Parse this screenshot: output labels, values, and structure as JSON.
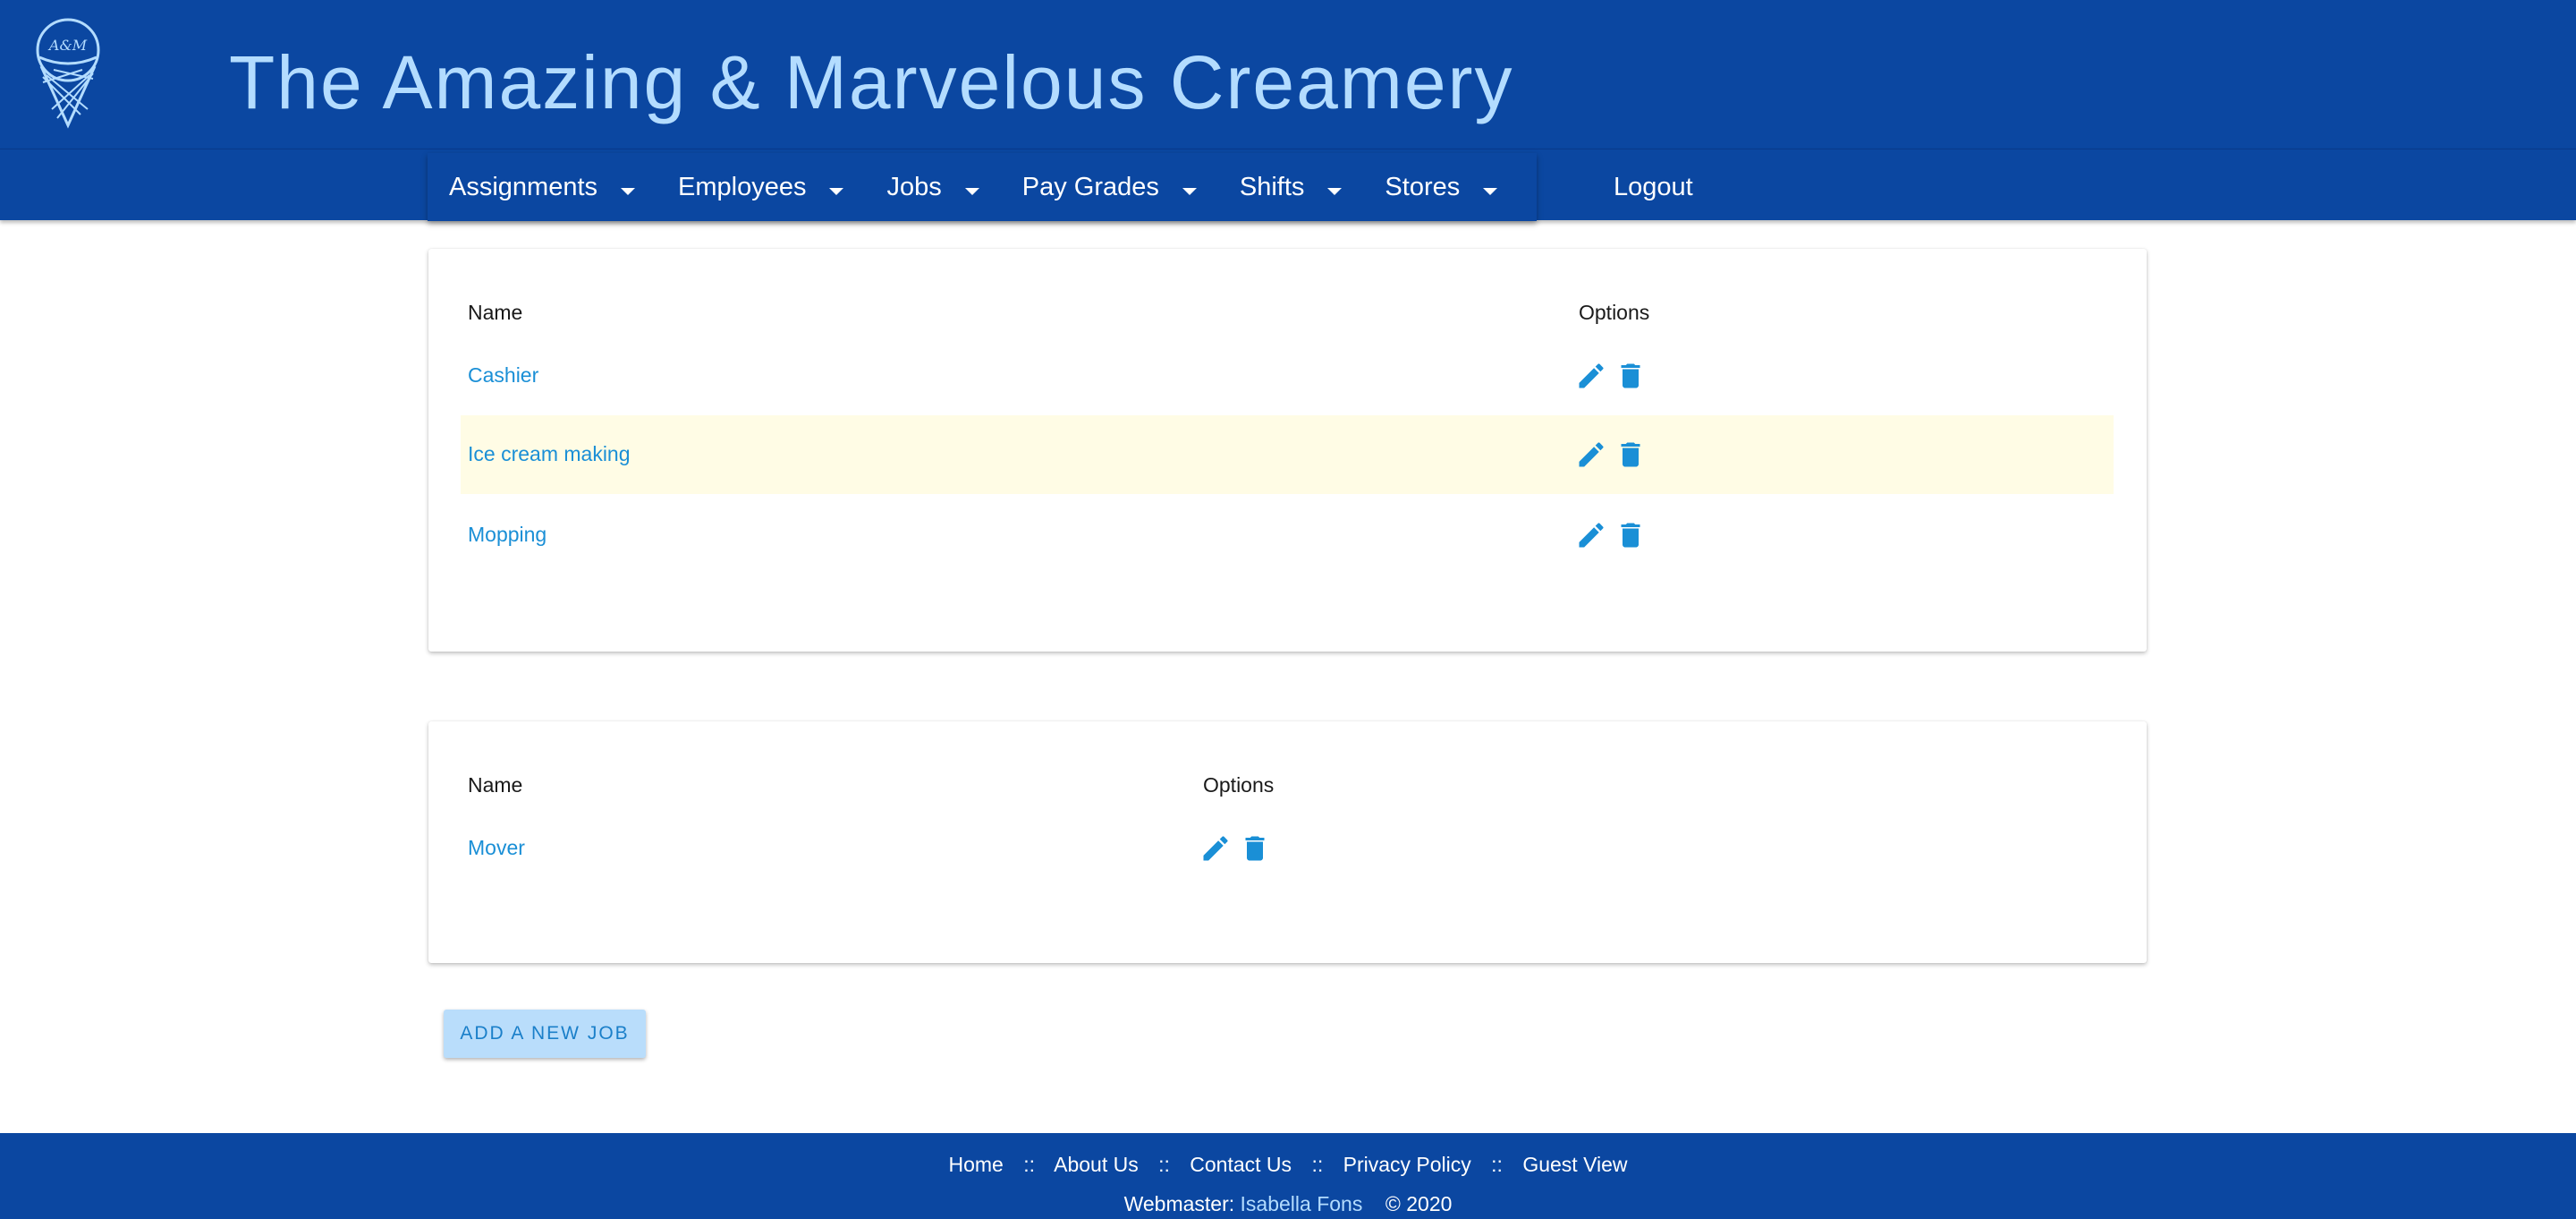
{
  "header": {
    "title": "The Amazing & Marvelous Creamery",
    "logo_icon": "ice-cream-cone-icon",
    "logo_text": "A&M"
  },
  "nav": {
    "items": [
      {
        "label": "Assignments",
        "icon": "caret-down-icon"
      },
      {
        "label": "Employees",
        "icon": "caret-down-icon"
      },
      {
        "label": "Jobs",
        "icon": "caret-down-icon"
      },
      {
        "label": "Pay Grades",
        "icon": "caret-down-icon"
      },
      {
        "label": "Shifts",
        "icon": "caret-down-icon"
      },
      {
        "label": "Stores",
        "icon": "caret-down-icon"
      }
    ],
    "logout_label": "Logout"
  },
  "active_jobs": {
    "headers": {
      "name": "Name",
      "options": "Options"
    },
    "rows": [
      {
        "name": "Cashier",
        "highlighted": false
      },
      {
        "name": "Ice cream making",
        "highlighted": true
      },
      {
        "name": "Mopping",
        "highlighted": false
      }
    ]
  },
  "inactive_jobs": {
    "headers": {
      "name": "Name",
      "options": "Options"
    },
    "rows": [
      {
        "name": "Mover",
        "highlighted": false
      }
    ]
  },
  "actions": {
    "add_job_label": "ADD A NEW JOB",
    "edit_icon": "pencil-icon",
    "delete_icon": "trash-icon"
  },
  "footer": {
    "links": [
      "Home",
      "About Us",
      "Contact Us",
      "Privacy Policy",
      "Guest View"
    ],
    "separator": "::",
    "webmaster_label": "Webmaster:",
    "webmaster_name": "Isabella Fons",
    "copyright": "© 2020"
  },
  "colors": {
    "brand_blue": "#0b47a1",
    "title_light_blue": "#b3dcff",
    "link_blue": "#1a8fd6",
    "row_highlight": "#fffce5",
    "button_bg": "#b9ddfb"
  }
}
